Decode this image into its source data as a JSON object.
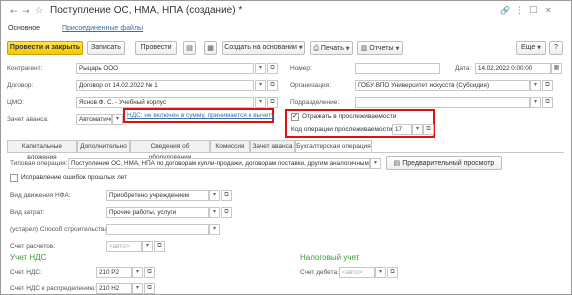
{
  "title": "Поступление ОС, НМА, НПА (создание) *",
  "nav": {
    "back": "←",
    "forward": "→",
    "star": "☆"
  },
  "window_icons": {
    "link": "🔗",
    "more": "⋮",
    "maximize": "□",
    "close": "✕"
  },
  "tabs_top": {
    "main": "Основное",
    "attached": "Присоединенные файлы"
  },
  "toolbar": {
    "post_close": "Провести и закрыть",
    "save": "Записать",
    "post": "Провести",
    "create_based": "Создать на основании",
    "print": "Печать",
    "reports": "Отчеты",
    "more": "Еще",
    "help": "?"
  },
  "form": {
    "contractor_label": "Контрагент:",
    "contractor_value": "Рыцарь ООО",
    "contract_label": "Договор:",
    "contract_value": "Договор от 14.02.2022 № 1",
    "mol_label": "ЦМО:",
    "mol_value": "Яснов Ф. С. - Учебный корпус",
    "advance_label": "Зачет аванса:",
    "advance_value": "Автоматически",
    "vat_link": "НДС: не включен в сумму, принимается к вычету",
    "number_label": "Номер:",
    "number_value": "",
    "date_label": "Дата:",
    "date_value": "14.02.2022  0:00:00",
    "org_label": "Организация:",
    "org_value": "ГОБУ ВПО Университет искусств (Субсидия)",
    "division_label": "Подразделение:",
    "division_value": "",
    "trace_checkbox": "Отражать в прослеживаемости",
    "trace_code_label": "Код операции прослеживаемости:",
    "trace_code_value": "17"
  },
  "tabs": [
    "Капитальные вложения",
    "Дополнительно",
    "Сведения об оборудовании",
    "Комиссия",
    "Зачет аванса",
    "Бухгалтерская операция"
  ],
  "accounting": {
    "op_label": "Типовая операция:",
    "op_value": "Поступление ОС, НМА, НПА по договорам купли-продажи, договорам поставки, другим аналогичным договорам",
    "preview_button": "Предварительный просмотр",
    "fix_errors": "Исправление ошибок прошлых лет",
    "nfa_label": "Вид движения НФА:",
    "nfa_value": "Приобретено учреждением",
    "cost_label": "Вид затрат:",
    "cost_value": "Прочие работы, услуги",
    "construction_label": "(устарел) Способ строительства:",
    "settlement_label": "Счет расчетов:",
    "auto_placeholder": "<авто>",
    "vat_section": "Учет НДС",
    "vat_account_label": "Счет НДС:",
    "vat_account_value": "210 Р2",
    "vat_distr_label": "Счет НДС к распределению:",
    "vat_distr_value": "210 Н2",
    "tax_section": "Налоговый учет",
    "debit_label": "Счет дебета:"
  }
}
